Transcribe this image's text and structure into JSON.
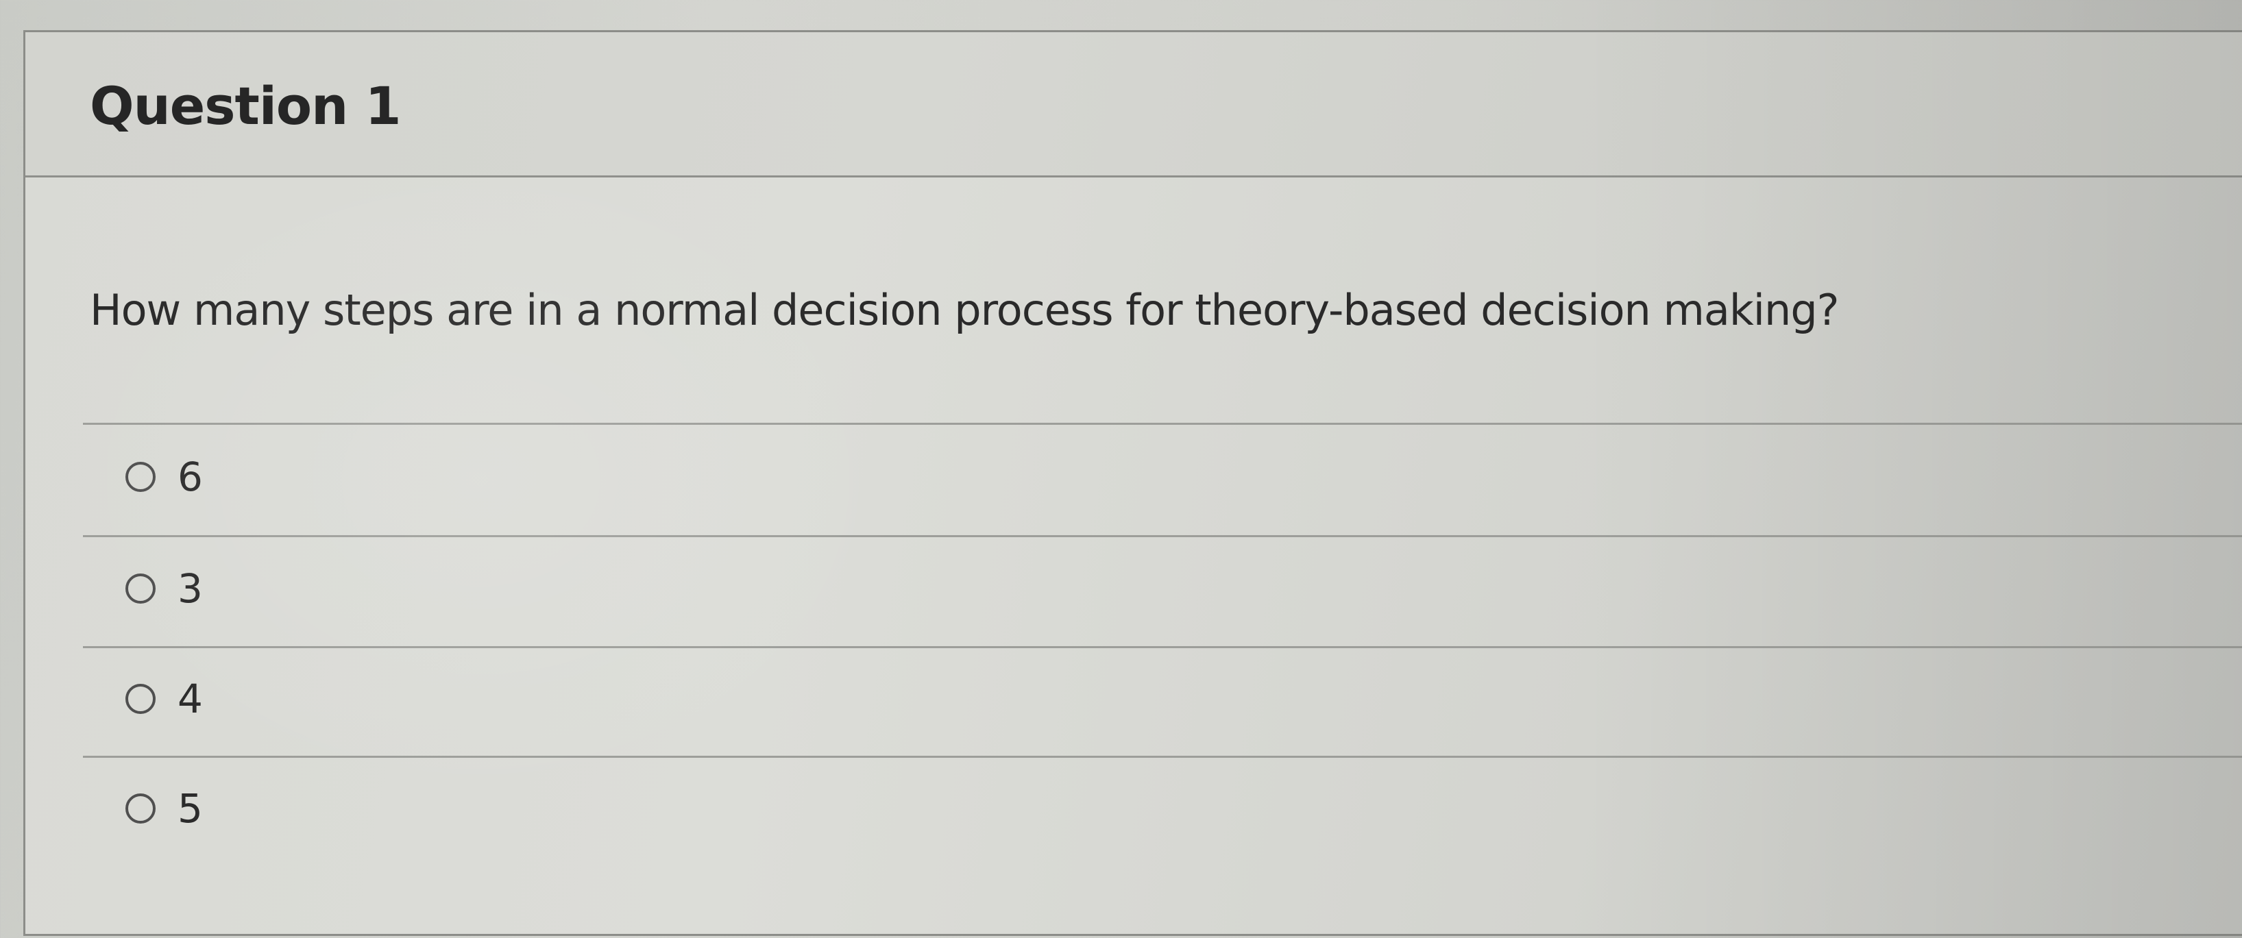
{
  "question": {
    "title": "Question 1",
    "prompt": "How many steps are in a normal decision process for theory-based decision making?"
  },
  "answers": [
    {
      "label": "6",
      "selected": false
    },
    {
      "label": "3",
      "selected": false
    },
    {
      "label": "4",
      "selected": false
    },
    {
      "label": "5",
      "selected": false
    }
  ]
}
